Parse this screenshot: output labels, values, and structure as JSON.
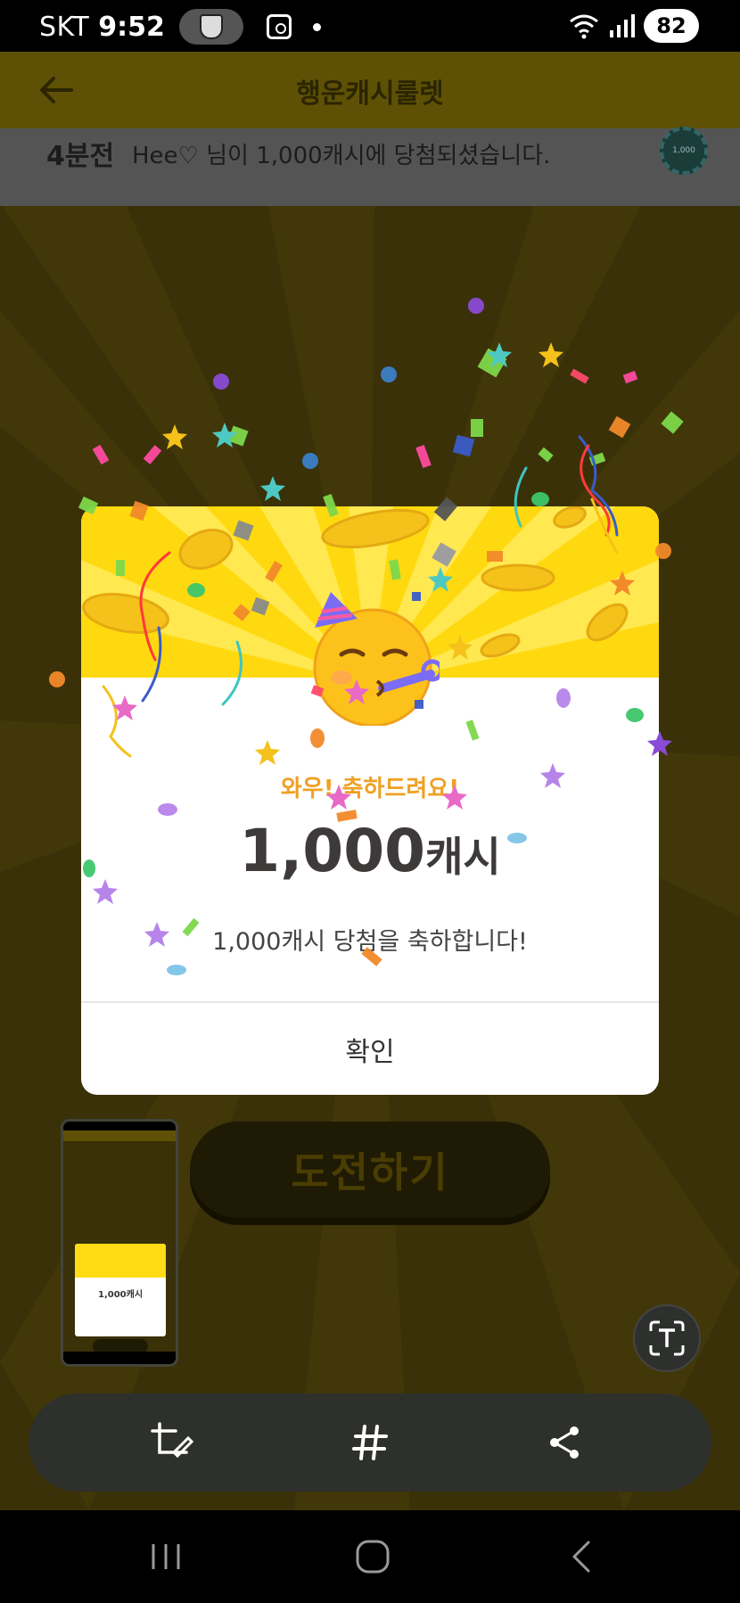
{
  "status_bar": {
    "carrier": "SKT",
    "time": "9:52",
    "battery": "82"
  },
  "header": {
    "title": "행운캐시룰렛"
  },
  "ticker": {
    "time_ago": "4분전",
    "message": "Hee♡ 님이 1,000캐시에 당첨되셨습니다.",
    "badge": "1,000"
  },
  "dialog": {
    "subtitle": "와우! 축하드려요!",
    "amount": "1,000",
    "unit": "캐시",
    "message": "1,000캐시 당첨을 축하합니다!",
    "confirm": "확인"
  },
  "challenge_button": "도전하기",
  "thumbnail": {
    "amount": "1,000캐시"
  },
  "colors": {
    "accent": "#ffd90f",
    "subtitle": "#f0a023",
    "overlay_bg": "#3a3109"
  },
  "icons": [
    "back-arrow-icon",
    "crop-edit-icon",
    "hashtag-icon",
    "share-icon",
    "text-scan-icon",
    "recent-apps-icon",
    "home-icon",
    "back-nav-icon"
  ]
}
